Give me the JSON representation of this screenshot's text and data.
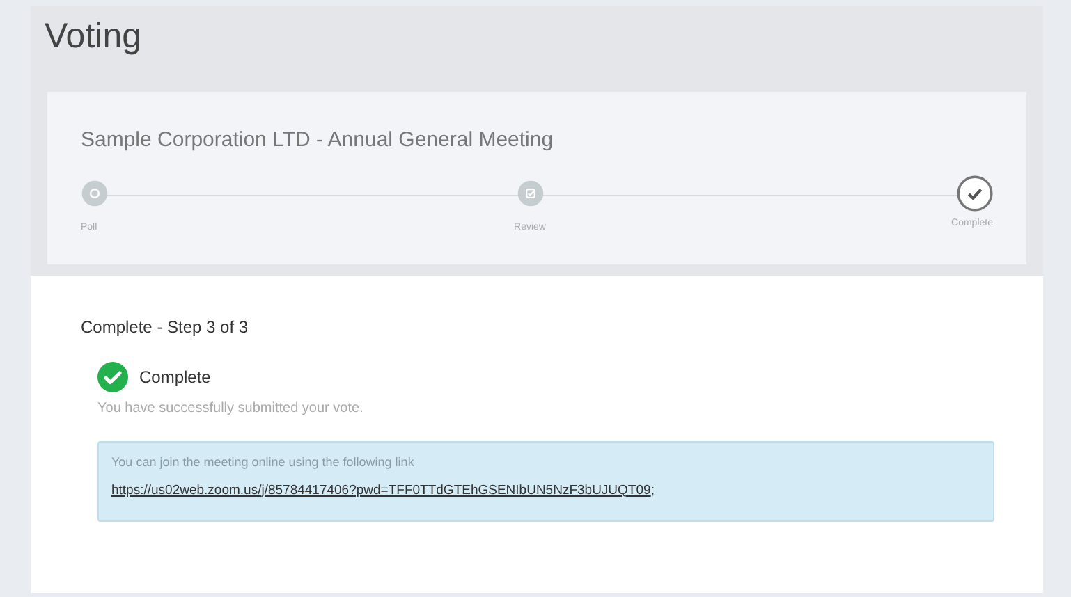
{
  "page_title": "Voting",
  "meeting": {
    "title": "Sample Corporation LTD - Annual General Meeting",
    "steps": [
      {
        "label": "Poll",
        "kind": "poll",
        "selected": false
      },
      {
        "label": "Review",
        "kind": "review",
        "selected": false
      },
      {
        "label": "Complete",
        "kind": "complete",
        "selected": true
      }
    ]
  },
  "step_heading": "Complete - Step 3 of 3",
  "status": {
    "title": "Complete",
    "message": "You have successfully submitted your vote."
  },
  "info": {
    "text": "You can join the meeting online using the following link",
    "link": "https://us02web.zoom.us/j/85784417406?pwd=TFF0TTdGTEhGSENIbUN5NzF3bUJUQT09",
    "suffix": ";"
  }
}
